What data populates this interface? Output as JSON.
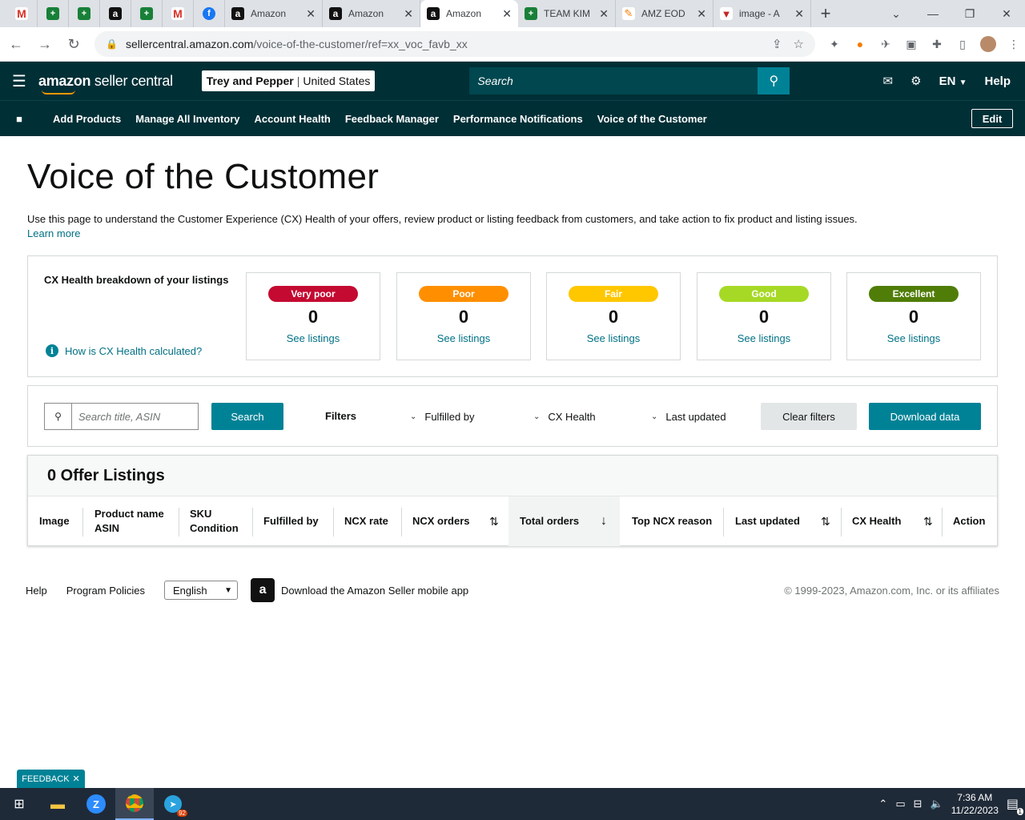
{
  "browser": {
    "tabs": [
      {
        "label": "Amazon",
        "active": false
      },
      {
        "label": "Amazon",
        "active": false
      },
      {
        "label": "Amazon",
        "active": true
      },
      {
        "label": "TEAM KIM",
        "active": false
      },
      {
        "label": "AMZ EOD",
        "active": false
      },
      {
        "label": "image - A",
        "active": false
      }
    ],
    "url_host": "sellercentral.amazon.com",
    "url_path": "/voice-of-the-customer/ref=xx_voc_favb_xx"
  },
  "header": {
    "logo_brand": "amazon",
    "logo_product": "seller central",
    "account_name": "Trey and Pepper",
    "account_separator": "|",
    "marketplace": "United States",
    "search_placeholder": "Search",
    "language": "EN",
    "help_label": "Help"
  },
  "nav": {
    "links": [
      "Add Products",
      "Manage All Inventory",
      "Account Health",
      "Feedback Manager",
      "Performance Notifications",
      "Voice of the Customer"
    ],
    "edit_label": "Edit"
  },
  "page": {
    "title": "Voice of the Customer",
    "description": "Use this page to understand the Customer Experience (CX) Health of your offers, review product or listing feedback from customers, and take action to fix product and listing issues.",
    "learn_more": "Learn more"
  },
  "health": {
    "title": "CX Health breakdown of your listings",
    "info_link": "How is CX Health calculated?",
    "cards": [
      {
        "label": "Very poor",
        "count": "0",
        "link": "See listings",
        "color": "#c40a31"
      },
      {
        "label": "Poor",
        "count": "0",
        "link": "See listings",
        "color": "#ff8f00"
      },
      {
        "label": "Fair",
        "count": "0",
        "link": "See listings",
        "color": "#ffc700"
      },
      {
        "label": "Good",
        "count": "0",
        "link": "See listings",
        "color": "#a6d925"
      },
      {
        "label": "Excellent",
        "count": "0",
        "link": "See listings",
        "color": "#507d07"
      }
    ]
  },
  "filters": {
    "search_placeholder": "Search title, ASIN",
    "search_button": "Search",
    "filters_label": "Filters",
    "dropdowns": [
      "Fulfilled by",
      "CX Health",
      "Last updated"
    ],
    "clear_button": "Clear filters",
    "download_button": "Download data"
  },
  "table": {
    "title": "0 Offer Listings",
    "columns": {
      "image": "Image",
      "product_line1": "Product name",
      "product_line2": "ASIN",
      "sku_line1": "SKU",
      "sku_line2": "Condition",
      "fulfilled": "Fulfilled by",
      "ncx_rate": "NCX rate",
      "ncx_orders": "NCX orders",
      "total_orders": "Total orders",
      "top_reason": "Top NCX reason",
      "last_updated": "Last updated",
      "cx_health": "CX Health",
      "action": "Action"
    }
  },
  "footer": {
    "help": "Help",
    "policies": "Program Policies",
    "language": "English",
    "app_text": "Download the Amazon Seller mobile app",
    "copyright": "© 1999-2023, Amazon.com, Inc. or its affiliates"
  },
  "feedback_tab": {
    "label": "FEEDBACK"
  },
  "taskbar": {
    "time": "7:36 AM",
    "date": "11/22/2023",
    "telegram_badge": "92",
    "notif_count": "1"
  },
  "colors": {
    "header_bg": "#002f36",
    "accent": "#008296",
    "link": "#007185"
  }
}
